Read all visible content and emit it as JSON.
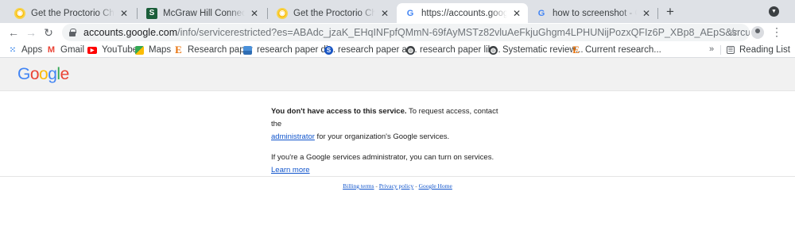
{
  "tabs": [
    {
      "title": "Get the Proctorio Chrome Exte",
      "favicon": "proctorio-icon",
      "active": false
    },
    {
      "title": "McGraw Hill Connect launch -",
      "favicon": "mcgraw-s-icon",
      "active": false
    },
    {
      "title": "Get the Proctorio Chrome Exte",
      "favicon": "proctorio-icon",
      "active": false
    },
    {
      "title": "https://accounts.google.com/i",
      "favicon": "google-g-icon",
      "active": true
    },
    {
      "title": "how to screenshot - Google Se",
      "favicon": "google-g-icon",
      "active": false
    }
  ],
  "toolbar": {
    "url_host": "accounts.google.com",
    "url_path": "/info/servicerestricted?es=ABAdc_jzaK_EHqINFpfQMmN-69fAyMSTz82vluAeFkjuGhgm4LPHUNijPozxQFIz6P_XBp8_AEpS&srcurl=https://chrome.google.co..."
  },
  "bookmarks": [
    {
      "label": "Apps",
      "icon": "apps-grid-icon"
    },
    {
      "label": "Gmail",
      "icon": "gmail-icon"
    },
    {
      "label": "YouTube",
      "icon": "youtube-icon"
    },
    {
      "label": "Maps",
      "icon": "maps-icon"
    },
    {
      "label": "Research paper",
      "icon": "e-icon"
    },
    {
      "label": "research paper di...",
      "icon": "image-icon"
    },
    {
      "label": "research paper ar...",
      "icon": "s-blue-icon"
    },
    {
      "label": "research paper lib...",
      "icon": "globe-icon"
    },
    {
      "label": "Systematic review...",
      "icon": "globe-icon"
    },
    {
      "label": "Current research...",
      "icon": "e-icon"
    }
  ],
  "reading_list": "Reading List",
  "logo": [
    "G",
    "o",
    "o",
    "g",
    "l",
    "e"
  ],
  "colors": {
    "blue": "#4285f4",
    "red": "#ea4335",
    "yellow": "#fbbc05",
    "green": "#34a853",
    "link": "#1155cc"
  },
  "message": {
    "bold": "You don't have access to this service.",
    "text1": " To request access, contact the",
    "admin_link": "administrator",
    "text2": " for your organization's Google services.",
    "para2": "If you're a Google services administrator, you can turn on services. ",
    "learn_more": "Learn more"
  },
  "footer": {
    "billing": "Billing terms",
    "sep": " - ",
    "privacy": "Privacy policy",
    "home": "Google Home"
  }
}
